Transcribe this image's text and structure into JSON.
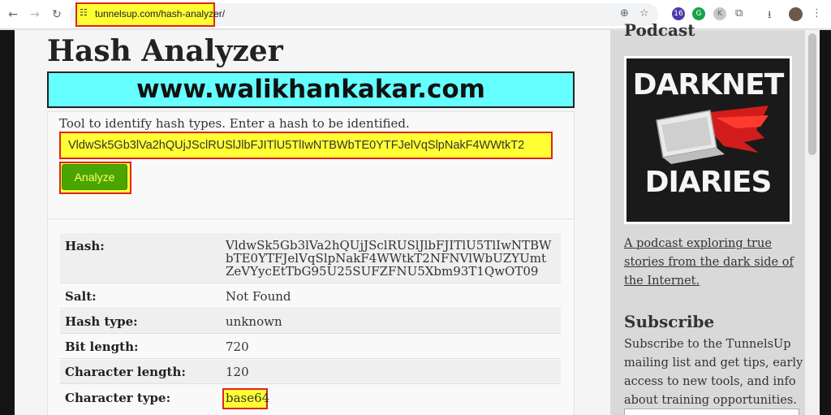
{
  "browser": {
    "url": "tunnelsup.com/hash-analyzer/",
    "back_icon": "←",
    "forward_icon": "→",
    "reload_icon": "↻",
    "zoom_icon": "⊕",
    "star_icon": "☆",
    "extensions_icon": "⧉",
    "download_icon": "⭳",
    "menu_icon": "⋮",
    "ext_badge": "16",
    "ext_k": "K"
  },
  "page": {
    "title": "Hash Analyzer",
    "banner_text": "www.walikhankakar.com",
    "description": "Tool to identify hash types. Enter a hash to be identified.",
    "hash_input_value": "VldwSk5Gb3lVa2hQUjJSclRUSlJlbFJITlU5TlIwNTBWbTE0YTFJelVqSlpNakF4WWtkT2",
    "analyze_label": "Analyze"
  },
  "results": {
    "hash_label": "Hash:",
    "hash_value": "VldwSk5Gb3lVa2hQUjJSclRUSlJlbFJITlU5TlIwNTBWbTE0YTFJelVqSlpNakF4WWtkT2NFNVlWbUZYUmtZeVYycEtTbG95U25SUFZFNU5Xbm93T1QwOT09",
    "salt_label": "Salt:",
    "salt_value": "Not Found",
    "hash_type_label": "Hash type:",
    "hash_type_value": "unknown",
    "bit_length_label": "Bit length:",
    "bit_length_value": "720",
    "char_length_label": "Character length:",
    "char_length_value": "120",
    "char_type_label": "Character type:",
    "char_type_value": "base64"
  },
  "sidebar": {
    "podcast_heading": "Podcast",
    "art_top": "DARKNET",
    "art_bottom": "DIARIES",
    "podcast_link": "A podcast exploring true stories from the dark side of the Internet.",
    "subscribe_heading": "Subscribe",
    "subscribe_text": "Subscribe to the TunnelsUp mailing list and get tips, early access to new tools, and info about training opportunities."
  },
  "colors": {
    "highlight": "#ffff33",
    "highlight_border": "#e0241b",
    "banner": "#66ffff",
    "button": "#4aa500"
  }
}
